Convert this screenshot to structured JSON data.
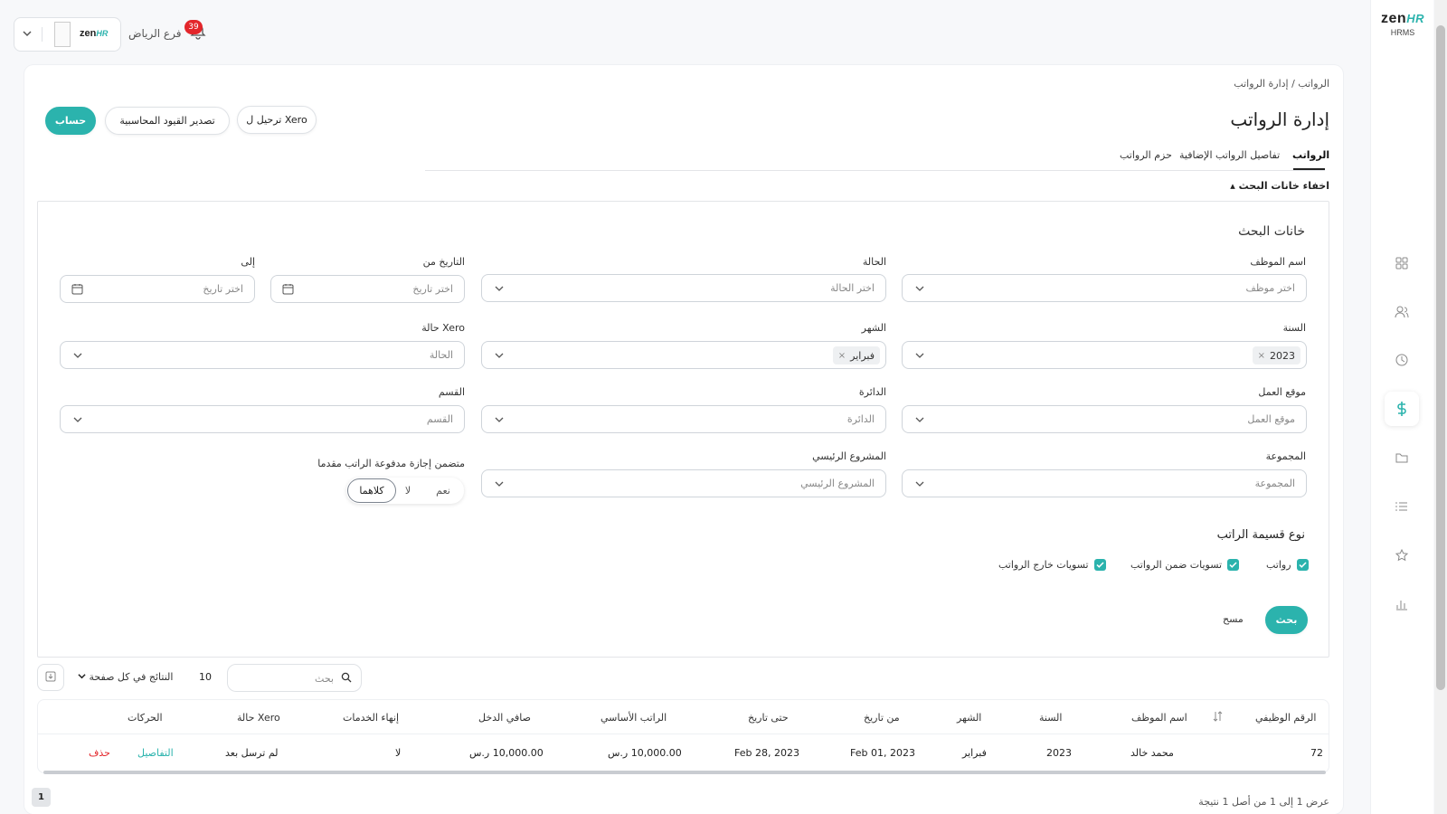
{
  "brand": {
    "logo_text": "zen",
    "logo_accent": "HR",
    "product": "HRMS",
    "accent_color": "#2bb3ad"
  },
  "topbar": {
    "branch": "فرع الرياض",
    "notifications_count": "39",
    "company_logo_text": "zen",
    "company_logo_accent": "HR"
  },
  "sidebar": {
    "icons": [
      "grid-icon",
      "users-icon",
      "clock-icon",
      "dollar-icon",
      "folder-icon",
      "list-icon",
      "star-icon",
      "bar-chart-icon"
    ],
    "active": "dollar-icon"
  },
  "breadcrumb": {
    "text": "الرواتب / إدارة الرواتب"
  },
  "page": {
    "title": "إدارة الرواتب"
  },
  "actions": {
    "calculate": "حساب",
    "export_entries": "تصدير القيود المحاسبية",
    "post_xero": "ترحيل ل Xero"
  },
  "tabs": [
    {
      "label": "الرواتب",
      "active": true
    },
    {
      "label": "تفاصيل الرواتب الإضافية",
      "active": false
    },
    {
      "label": "حزم الرواتب",
      "active": false
    }
  ],
  "search": {
    "toggle_label": "اخفاء خانات البحث ▴",
    "title": "خانات البحث",
    "fields": {
      "employee_name": {
        "label": "اسم الموظف",
        "placeholder": "اختر موظف"
      },
      "status": {
        "label": "الحالة",
        "placeholder": "اختر الحالة"
      },
      "date_from": {
        "label": "التاريخ من",
        "placeholder": "اختر تاريخ"
      },
      "date_to": {
        "label": "إلى",
        "placeholder": "اختر تاريخ"
      },
      "year": {
        "label": "السنة",
        "value": "2023"
      },
      "month": {
        "label": "الشهر",
        "value": "فبراير"
      },
      "xero_status": {
        "label": "حالة Xero",
        "placeholder": "الحالة"
      },
      "work_location": {
        "label": "موقع العمل",
        "placeholder": "موقع العمل"
      },
      "department": {
        "label": "الدائرة",
        "placeholder": "الدائرة"
      },
      "section": {
        "label": "القسم",
        "placeholder": "القسم"
      },
      "group": {
        "label": "المجموعة",
        "placeholder": "المجموعة"
      },
      "main_project": {
        "label": "المشروع الرئيسي",
        "placeholder": "المشروع الرئيسي"
      },
      "includes_advance_leave": {
        "label": "متضمن إجازة مدفوعة الراتب مقدما",
        "options": [
          "نعم",
          "لا",
          "كلاهما"
        ],
        "selected": "كلاهما"
      }
    },
    "slip_type": {
      "title": "نوع قسيمة الراتب",
      "options": [
        "رواتب",
        "تسويات ضمن الرواتب",
        "تسويات خارج الرواتب"
      ]
    },
    "search_button": "بحث",
    "clear_button": "مسح"
  },
  "table_controls": {
    "per_page_label": "النتائج في كل صفحة",
    "per_page_value": "10",
    "search_placeholder": "بحث"
  },
  "table": {
    "headers": [
      "الرقم الوظيفي",
      "اسم الموظف",
      "السنة",
      "الشهر",
      "من تاريخ",
      "حتى تاريخ",
      "الراتب الأساسي",
      "صافي الدخل",
      "إنهاء الخدمات",
      "حالة Xero",
      "الحركات"
    ],
    "rows": [
      {
        "employee_no": "72",
        "employee_name": "محمد خالد",
        "year": "2023",
        "month": "فبراير",
        "from_date": "Feb 01, 2023",
        "to_date": "Feb 28, 2023",
        "basic_salary": "10,000.00 ر.س",
        "net_income": "10,000.00 ر.س",
        "end_of_service": "لا",
        "xero_status": "لم ترسل بعد",
        "action_details": "التفاصيل",
        "action_delete": "حذف"
      }
    ]
  },
  "pagination": {
    "current_page": "1",
    "info": "عرض 1 إلى 1 من أصل 1 نتيجة"
  }
}
